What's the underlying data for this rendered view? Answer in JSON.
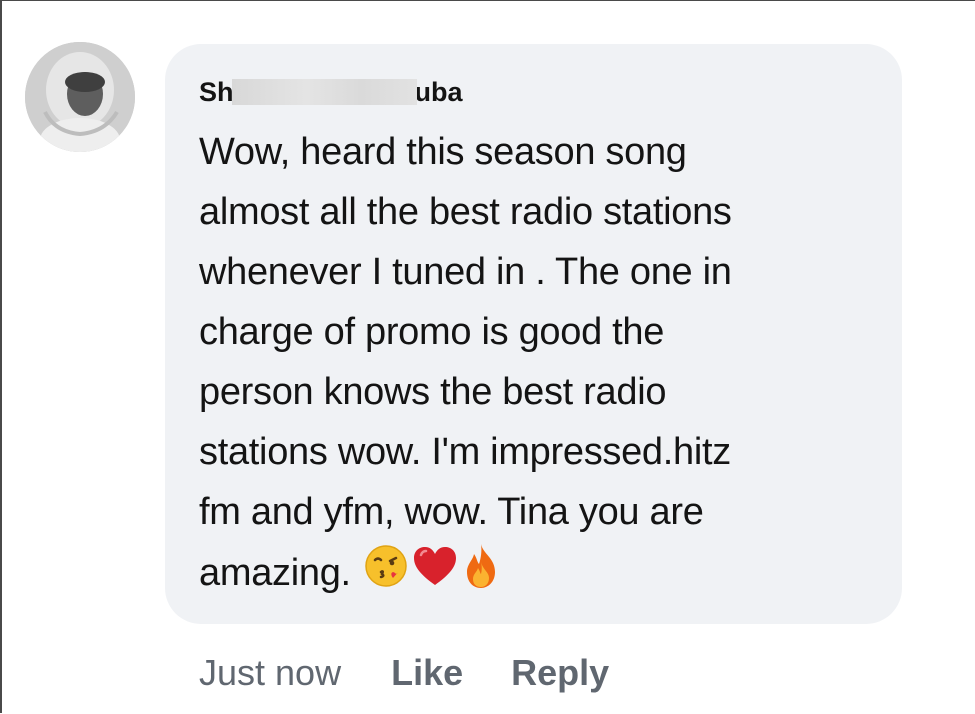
{
  "comment": {
    "author_prefix": "Sh",
    "author_suffix": "uba",
    "lines": [
      "Wow, heard this season song",
      "almost all the best radio stations",
      "whenever I tuned in . The one in",
      "charge of promo is good the",
      "person knows the best radio",
      "stations wow. I'm impressed.hitz",
      "fm and yfm, wow. Tina you are",
      "amazing."
    ],
    "emojis": [
      "face-blowing-kiss-icon",
      "red-heart-icon",
      "fire-icon"
    ]
  },
  "actions": {
    "timestamp": "Just now",
    "like_label": "Like",
    "reply_label": "Reply"
  },
  "colors": {
    "bubble_bg": "#f0f2f5",
    "text": "#141414",
    "secondary_text": "#606770"
  }
}
